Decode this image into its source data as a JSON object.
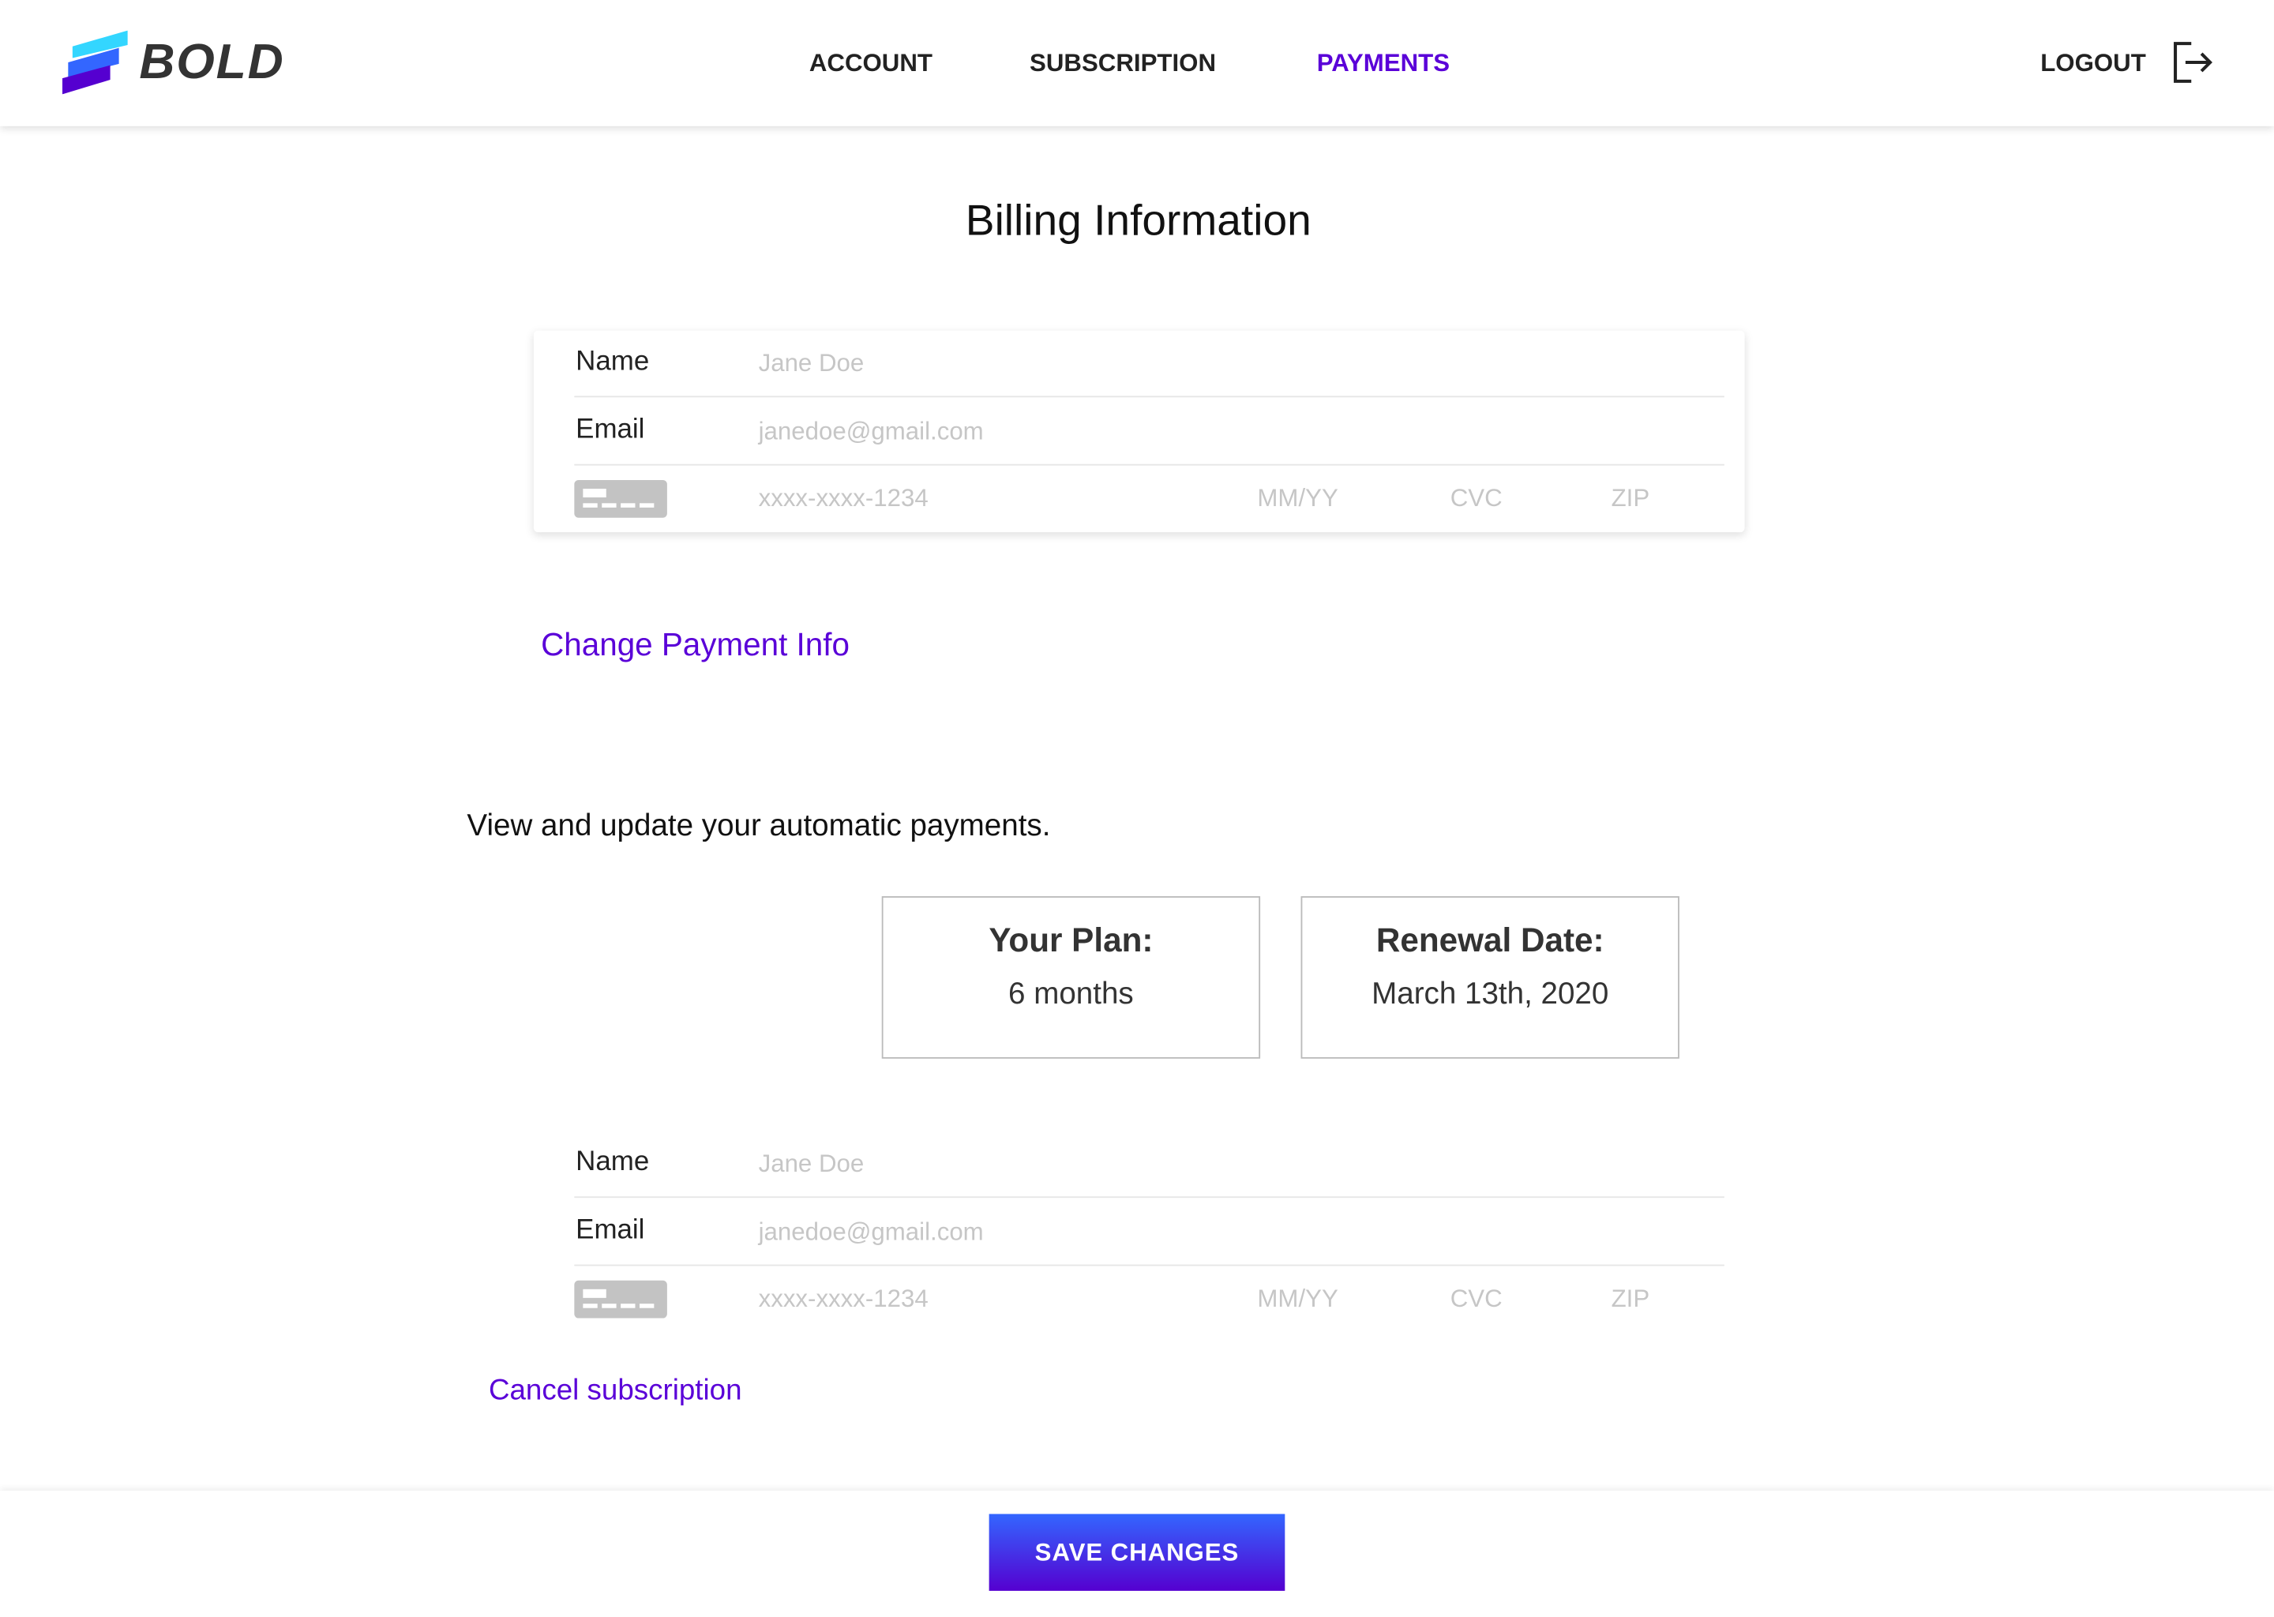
{
  "header": {
    "logo": "BOLD",
    "nav": [
      {
        "label": "ACCOUNT"
      },
      {
        "label": "SUBSCRIPTION"
      },
      {
        "label": "PAYMENTS",
        "active": true
      }
    ],
    "logout": "LOGOUT"
  },
  "colors": {
    "accent": "#5a00d8",
    "button_top": "#3366ff",
    "button_bottom": "#5500d0"
  },
  "title": "Billing Information",
  "billing": {
    "name_label": "Name",
    "name_value": "Jane Doe",
    "email_label": "Email",
    "email_value": "janedoe@gmail.com",
    "card_number": "xxxx-xxxx-1234",
    "expiry": "MM/YY",
    "cvc": "CVC",
    "zip": "ZIP"
  },
  "change_payment": "Change Payment Info",
  "auto_text": "View and update your automatic payments.",
  "plan": {
    "title": "Your Plan:",
    "value": "6 months"
  },
  "renewal": {
    "title": "Renewal Date:",
    "value": "March 13th, 2020"
  },
  "auto": {
    "name_label": "Name",
    "name_value": "Jane Doe",
    "email_label": "Email",
    "email_value": "janedoe@gmail.com",
    "card_number": "xxxx-xxxx-1234",
    "expiry": "MM/YY",
    "cvc": "CVC",
    "zip": "ZIP"
  },
  "cancel": "Cancel subscription",
  "save": "SAVE CHANGES"
}
